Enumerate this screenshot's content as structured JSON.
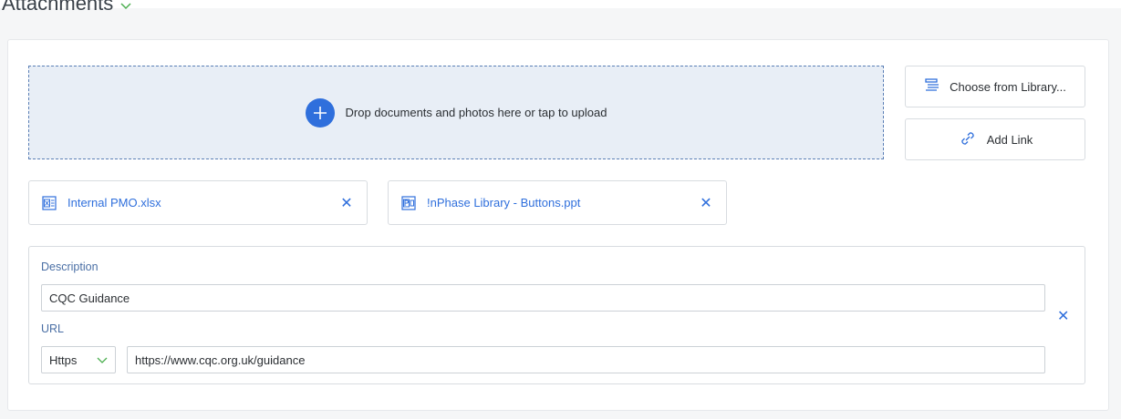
{
  "section": {
    "title": "Attachments"
  },
  "dropzone": {
    "text": "Drop documents and photos here or tap to upload"
  },
  "buttons": {
    "library": "Choose from Library...",
    "add_link": "Add Link"
  },
  "files": [
    {
      "name": "Internal PMO.xlsx",
      "close": "✕"
    },
    {
      "name": "!nPhase Library - Buttons.ppt",
      "close": "✕"
    }
  ],
  "link": {
    "description_label": "Description",
    "description_value": "CQC Guidance",
    "url_label": "URL",
    "protocol": "Https",
    "url_value": "https://www.cqc.org.uk/guidance",
    "close": "✕"
  },
  "colors": {
    "accent": "#2f6fdc",
    "dropzone_bg": "#e8eef6",
    "label": "#4a6fa5",
    "chevron": "#4caf50"
  }
}
